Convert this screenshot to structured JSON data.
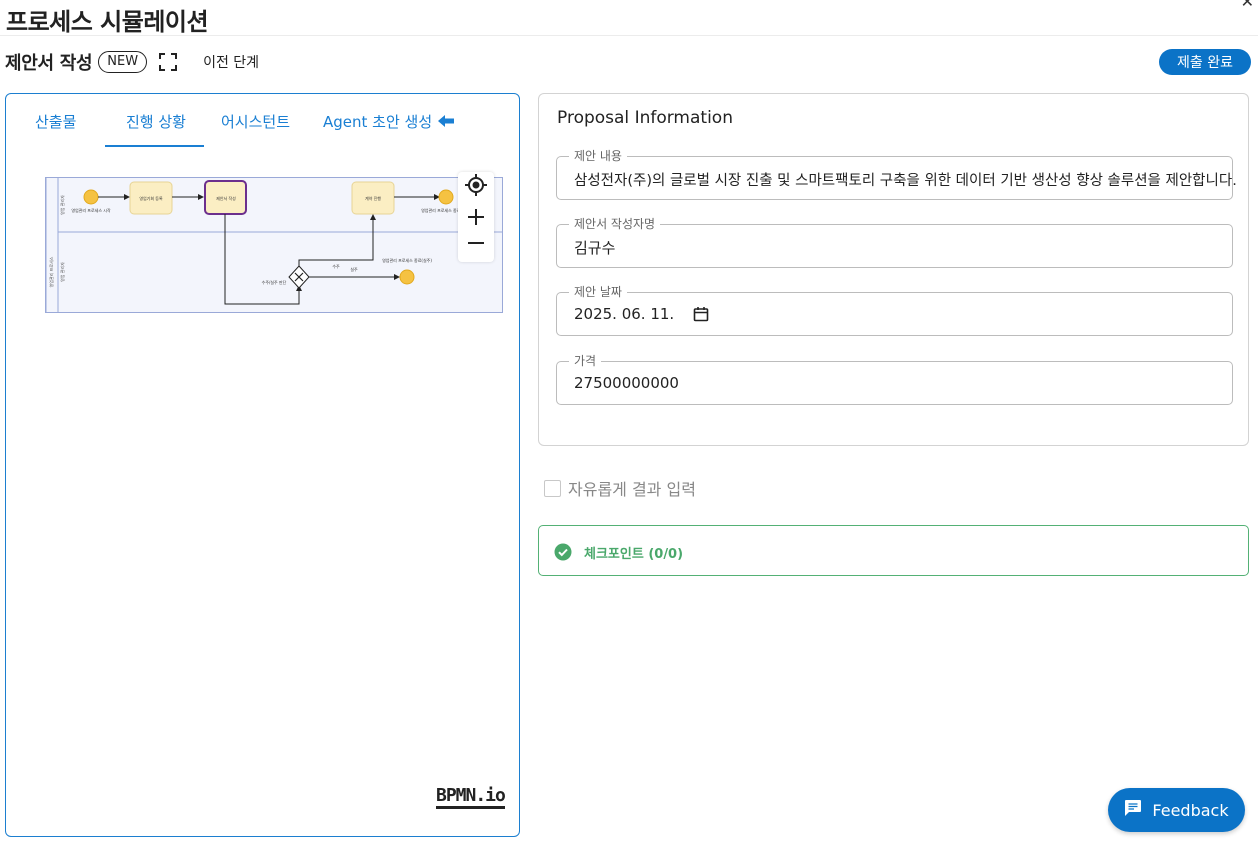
{
  "page": {
    "title": "프로세스 시뮬레이션"
  },
  "step": {
    "title": "제안서 작성",
    "badge": "NEW",
    "prev_label": "이전 단계",
    "submit_label": "제출 완료"
  },
  "tabs": [
    {
      "label": "산출물"
    },
    {
      "label": "진행 상황",
      "active": true
    },
    {
      "label": "어시스턴트"
    },
    {
      "label": "Agent 초안 생성"
    }
  ],
  "diagram": {
    "lanes": [
      "영업 관리자",
      "영업관리 프로세스"
    ],
    "nodes": {
      "start_event": "영업관리 프로세스 시작",
      "task_register": "영업기회 등록",
      "task_proposal": "제안서 작성",
      "task_contract": "계약 진행",
      "gateway": "수주/실주 판단",
      "end_won": "영업관리 프로세스 종료(수주)",
      "end_lost": "영업관리 프로세스 종료(실주)",
      "flow_won": "수주",
      "flow_lost": "실주"
    },
    "logo": "BPMN.io"
  },
  "form": {
    "title": "Proposal Information",
    "fields": [
      {
        "label": "제안 내용",
        "value": "삼성전자(주)의 글로벌 시장 진출 및 스마트팩토리 구축을 위한 데이터 기반 생산성 향상 솔루션을 제안합니다."
      },
      {
        "label": "제안서 작성자명",
        "value": "김규수"
      },
      {
        "label": "제안 날짜",
        "value": "2025. 06. 11."
      },
      {
        "label": "가격",
        "value": "27500000000"
      }
    ]
  },
  "free_input": {
    "label": "자유롭게 결과 입력",
    "checked": false
  },
  "checkpoint": {
    "label": "체크포인트 (0/0)"
  },
  "feedback": {
    "label": "Feedback"
  },
  "colors": {
    "primary": "#0b73c7",
    "tab_accent": "#1a7fd3",
    "success": "#4aa86b",
    "task_fill": "#fbeec3",
    "event_fill": "#f5c242"
  }
}
